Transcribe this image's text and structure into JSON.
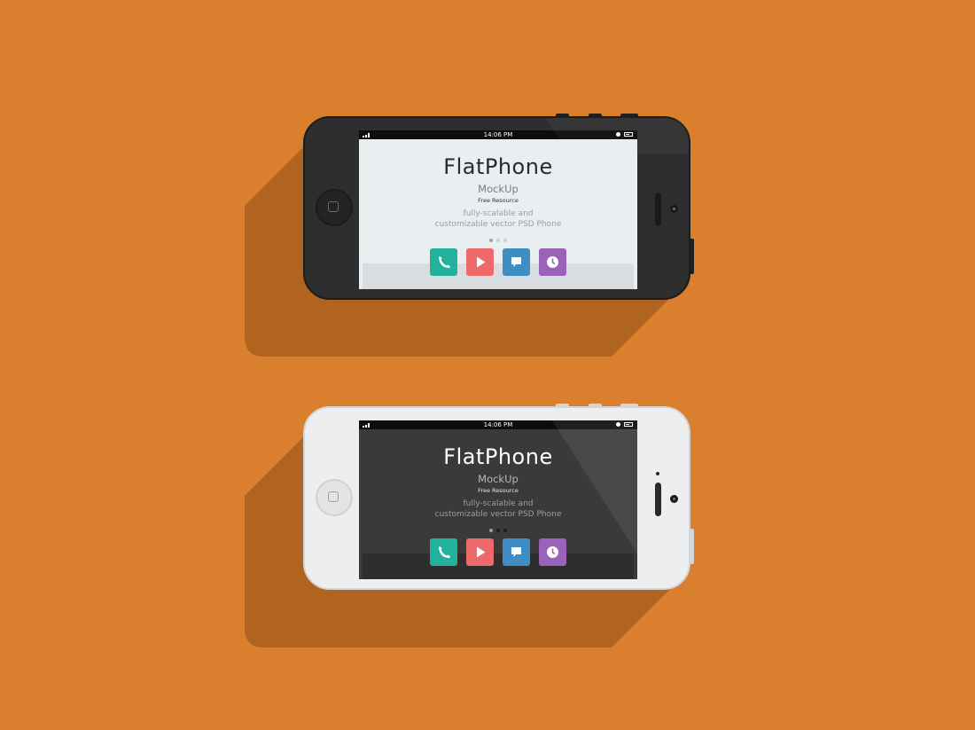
{
  "colors": {
    "background": "#d97f2e",
    "shadow": "#b06420",
    "phone_app": "#22b19a",
    "video_app": "#ec6a6a",
    "message_app": "#3e8ec3",
    "clock_app": "#9b62b7"
  },
  "phones": [
    {
      "variant": "black",
      "status_time": "14:06 PM",
      "title_thin": "Flat",
      "title_bold": "Phone",
      "subtitle": "MockUp",
      "tagline": "Free Resource",
      "desc_line1": "fully-scalable and",
      "desc_line2": "customizable vector PSD Phone",
      "apps": [
        "phone-icon",
        "play-icon",
        "message-icon",
        "clock-icon"
      ]
    },
    {
      "variant": "white",
      "status_time": "14:06 PM",
      "title_thin": "Flat",
      "title_bold": "Phone",
      "subtitle": "MockUp",
      "tagline": "Free Resource",
      "desc_line1": "fully-scalable and",
      "desc_line2": "customizable vector PSD Phone",
      "apps": [
        "phone-icon",
        "play-icon",
        "message-icon",
        "clock-icon"
      ]
    }
  ]
}
